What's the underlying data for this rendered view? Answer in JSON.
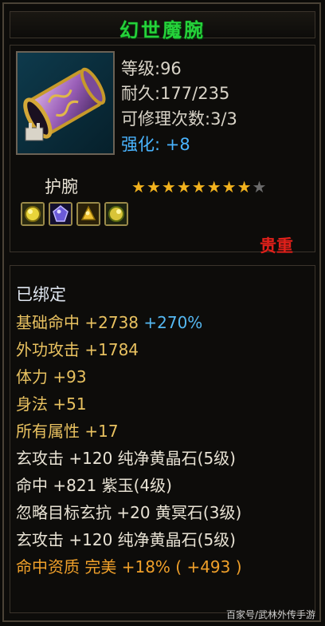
{
  "item": {
    "name": "幻世魔腕",
    "level_label": "等级:96",
    "durability_label": "耐久:177/235",
    "repair_label": "可修理次数:3/3",
    "strength_label": "强化:",
    "strength_value": "+8",
    "type": "护腕",
    "stars_filled": 8,
    "stars_total": 9,
    "rarity": "贵重"
  },
  "attributes": {
    "bound": "已绑定",
    "rows": [
      {
        "text": "基础命中 +2738",
        "extra": "+270%"
      },
      {
        "text": "外功攻击 +1784"
      },
      {
        "text": "体力 +93"
      },
      {
        "text": "身法 +51"
      },
      {
        "text": "所有属性 +17"
      },
      {
        "text": "玄攻击 +120 纯净黄晶石(5级)"
      },
      {
        "text": "命中 +821 紫玉(4级)"
      },
      {
        "text": "忽略目标玄抗 +20 黄冥石(3级)"
      },
      {
        "text": "玄攻击 +120 纯净黄晶石(5级)"
      },
      {
        "text": "命中资质 完美 +18% ( +493 )"
      }
    ]
  },
  "colors": {
    "title": "#25d23a",
    "strength": "#49b4ff",
    "rarity": "#e0201a",
    "attr_gold": "#e8c160",
    "attr_blue": "#55b8f2"
  },
  "watermark": "百家号/武林外传手游"
}
